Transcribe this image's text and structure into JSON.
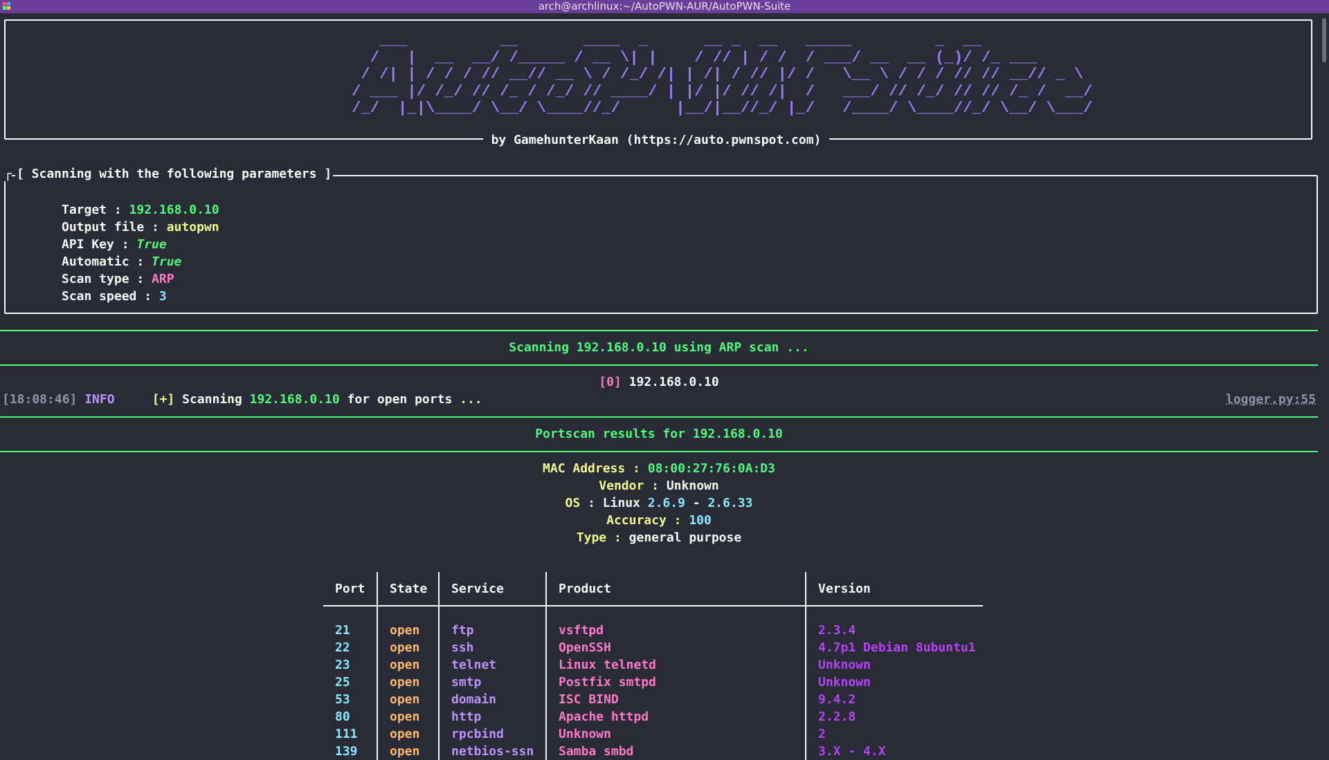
{
  "window": {
    "title": "arch@archlinux:~/AutoPWN-AUR/AutoPWN-Suite"
  },
  "banner": {
    "ascii_lines": [
      "   ___          __       ____  _      __ _  __   _____         _  __",
      "  /   |  __  __/ /_____ / __ \\| |    / // | / /  / ___/ __  __ (_)/ /_ ___",
      " / /| | / / / // __// __ \\ / /_/ /| | /| / // |/ /   \\__ \\ / / / // // __// _ \\",
      "/ ___ |/ /_/ // /_ / /_/ // ____/ | |/ |/ // /|  /   ___/ // /_/ // // /_ /  __/",
      "/_/  |_|\\____/ \\__/ \\____//_/      |__/|__//_/ |_/   /____/ \\____//_/ \\__/ \\___/"
    ],
    "credit": "by GamehunterKaan (https://auto.pwnspot.com)"
  },
  "params": {
    "title": "[ Scanning with the following parameters ]",
    "corner": "┌",
    "rows": [
      {
        "label": "Target : ",
        "value": "192.168.0.10"
      },
      {
        "label": "Output file : ",
        "value": "autopwn"
      },
      {
        "label": "API Key : ",
        "value": "True"
      },
      {
        "label": "Automatic : ",
        "value": "True"
      },
      {
        "label": "Scan type : ",
        "value": "ARP"
      },
      {
        "label": "Scan speed : ",
        "value": "3"
      }
    ]
  },
  "scan": {
    "heading": "Scanning 192.168.0.10 using ARP scan ...",
    "host_index": "[0]",
    "host_ip": "192.168.0.10"
  },
  "log": {
    "time": "[18:08:46]",
    "level": "INFO",
    "marker": "[+]",
    "msg_pre": "Scanning",
    "msg_ip": "192.168.0.10",
    "msg_post": "for open ports",
    "msg_dots": "...",
    "source": "logger.py:55"
  },
  "portscan": {
    "heading": "Portscan results for 192.168.0.10",
    "mac_label": "MAC Address : ",
    "mac": "08:00:27:76:0A:D3",
    "vendor_label": "Vendor : ",
    "vendor": "Unknown",
    "os_label": "OS : ",
    "os_name": "Linux",
    "os_v1": "2.6.9",
    "os_sep": "-",
    "os_v2": "2.6.33",
    "accuracy_label": "Accuracy : ",
    "accuracy": "100",
    "type_label": "Type : ",
    "type": "general purpose"
  },
  "table": {
    "headers": [
      "Port",
      "State",
      "Service",
      "Product",
      "Version"
    ],
    "rows": [
      [
        "21",
        "open",
        "ftp",
        "vsftpd",
        "2.3.4"
      ],
      [
        "22",
        "open",
        "ssh",
        "OpenSSH",
        "4.7p1 Debian 8ubuntu1"
      ],
      [
        "23",
        "open",
        "telnet",
        "Linux telnetd",
        "Unknown"
      ],
      [
        "25",
        "open",
        "smtp",
        "Postfix smtpd",
        "Unknown"
      ],
      [
        "53",
        "open",
        "domain",
        "ISC BIND",
        "9.4.2"
      ],
      [
        "80",
        "open",
        "http",
        "Apache httpd",
        "2.2.8"
      ],
      [
        "111",
        "open",
        "rpcbind",
        "Unknown",
        "2"
      ],
      [
        "139",
        "open",
        "netbios-ssn",
        "Samba smbd",
        "3.X - 4.X"
      ]
    ]
  },
  "colors": {
    "background": "#282a36",
    "titlebar": "#6a3d9a",
    "banner": "#9b7bf0",
    "green": "#50fa7b",
    "yellow": "#f1fa8c",
    "pink": "#ff79c6",
    "cyan": "#8be9fd",
    "purple": "#bd93f9",
    "orange": "#ffb86c",
    "magenta": "#b443f5"
  }
}
